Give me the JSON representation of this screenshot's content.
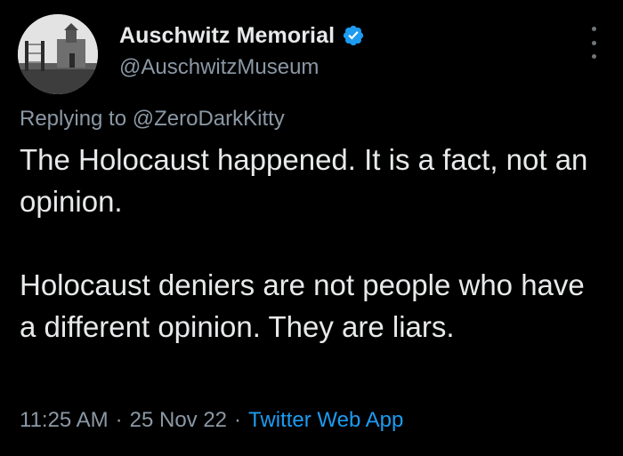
{
  "author": {
    "display_name": "Auschwitz Memorial",
    "handle": "@AuschwitzMuseum",
    "verified_color": "#1d9bf0"
  },
  "reply": {
    "prefix": "Replying to ",
    "to_handle": "@ZeroDarkKitty"
  },
  "tweet": {
    "paragraphs": [
      "The Holocaust happened. It is a fact, not an opinion.",
      "Holocaust deniers are not people who have a different opinion. They are liars."
    ]
  },
  "meta": {
    "time": "11:25 AM",
    "separator": "·",
    "date": "25 Nov 22",
    "source": "Twitter Web App"
  },
  "icons": {
    "verified": "verified-badge-icon",
    "more": "more-options-icon"
  },
  "colors": {
    "background": "#000000",
    "text": "#e7e9ea",
    "secondary": "#8b98a5",
    "accent": "#1d9bf0"
  }
}
